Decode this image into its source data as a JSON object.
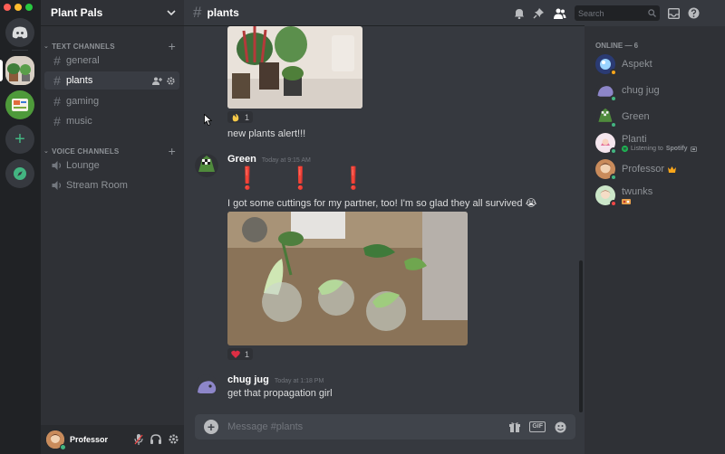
{
  "colors": {
    "blurple": "#7289da",
    "online": "#43b581",
    "idle": "#faa61a",
    "dnd": "#f04747",
    "crown": "#faa61a"
  },
  "guild": {
    "name": "Plant Pals"
  },
  "categories": {
    "text": "TEXT CHANNELS",
    "voice": "VOICE CHANNELS"
  },
  "text_channels": [
    {
      "name": "general",
      "active": false
    },
    {
      "name": "plants",
      "active": true
    },
    {
      "name": "gaming",
      "active": false
    },
    {
      "name": "music",
      "active": false
    }
  ],
  "voice_channels": [
    {
      "name": "Lounge"
    },
    {
      "name": "Stream Room"
    }
  ],
  "user": {
    "name": "Professor"
  },
  "channel": {
    "name": "plants"
  },
  "search": {
    "placeholder": "Search"
  },
  "messages": {
    "m0": {
      "reaction_emoji": "clap",
      "reaction_count": "1",
      "text": "new plants alert!!!"
    },
    "m1": {
      "author": "Green",
      "timestamp": "Today at 9:15 AM",
      "line1": "❗ ❗ ❗",
      "line2": "I got some cuttings for my partner, too! I'm so glad they all survived 😭",
      "reaction_emoji": "heart",
      "reaction_count": "1"
    },
    "m2": {
      "author": "chug jug",
      "timestamp": "Today at 1:18 PM",
      "text": "get that propagation girl"
    }
  },
  "composer": {
    "placeholder": "Message #plants"
  },
  "members": {
    "header": "ONLINE — 6",
    "list": [
      {
        "name": "Aspekt",
        "status": "idle"
      },
      {
        "name": "chug jug",
        "status": "online"
      },
      {
        "name": "Green",
        "status": "online"
      },
      {
        "name": "Planti",
        "status": "online",
        "activity_prefix": "Listening to ",
        "activity": "Spotify"
      },
      {
        "name": "Professor",
        "status": "online",
        "badge": "crown"
      },
      {
        "name": "twunks",
        "status": "dnd"
      }
    ]
  }
}
